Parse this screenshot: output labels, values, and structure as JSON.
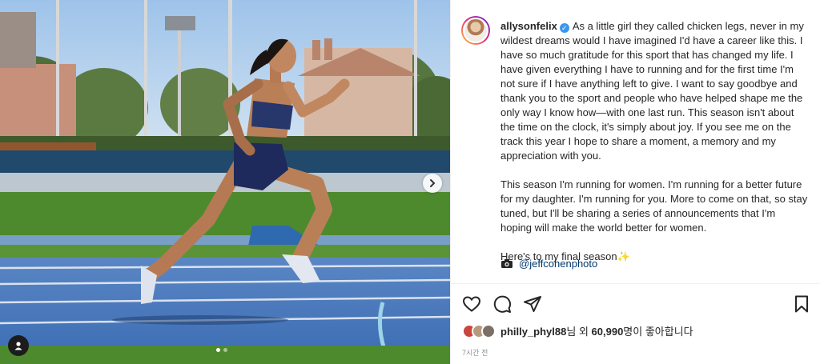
{
  "post": {
    "username": "allysonfelix",
    "verified_mark": "✓",
    "caption_paragraphs": [
      "As a little girl they called chicken legs, never in my wildest dreams would I have imagined I'd have a career like this. I have so much gratitude for this sport that has changed my life. I have given everything I have to running and for the first time I'm not sure if I have anything left to give. I want to say goodbye and thank you to the sport and people who have helped shape me the only way I know how—with one last run. This season isn't about the time on the clock, it's simply about joy. If you see me on the track this year I hope to share a moment, a memory and my appreciation with you.",
      "This season I'm running for women. I'm running for a better future for my daughter. I'm running for you. More to come on that, so stay tuned, but I'll be sharing a series of announcements that I'm hoping will make the world better for women.",
      "Here's to my final season✨"
    ],
    "photo_credit": "@jeffcohenphoto",
    "likes": {
      "first_liker": "philly_phyl88",
      "suffix_1": "님 외 ",
      "count": "60,990",
      "suffix_2": "명이 좋아합니다"
    },
    "timestamp": "7시간 전"
  },
  "carousel": {
    "slides": 2,
    "active_index": 0
  },
  "icons": {
    "like": "heart-outline-icon",
    "comment": "speech-bubble-icon",
    "share": "paper-plane-icon",
    "save": "bookmark-icon",
    "credit": "camera-icon",
    "tag": "person-tag-icon",
    "next": "chevron-right-icon"
  },
  "colors": {
    "link": "#00376b",
    "text": "#262626",
    "muted": "#8e8e8e",
    "verified": "#3897f0"
  }
}
